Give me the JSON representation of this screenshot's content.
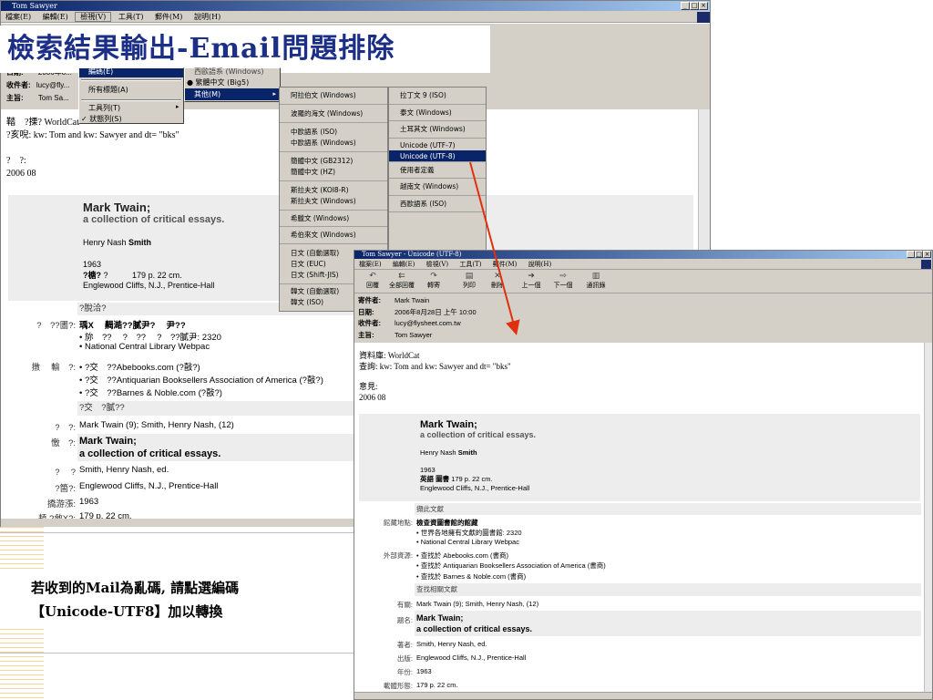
{
  "back_window": {
    "title": "Tom Sawyer",
    "menu": [
      "檔案(E)",
      "編輯(E)",
      "檢視(V)",
      "工具(T)",
      "郵件(M)",
      "說明(H)"
    ],
    "headers": [
      {
        "label": "日期:",
        "value": "2006年8..."
      },
      {
        "label": "收件者:",
        "value": "lucy@fly..."
      },
      {
        "label": "主旨:",
        "value": "Tom Sa..."
      }
    ],
    "body_lines": [
      "鞜　?搮? WorldCat",
      "?亥唲: kw: Tom and kw: Sawyer and dt= \"bks\"",
      "?　?:",
      "2006 08"
    ],
    "record": {
      "title": "Mark Twain;",
      "subtitle": "a collection of critical essays.",
      "author_prefix": "Henry Nash",
      "author_bold": "Smith",
      "year": "1963",
      "pages_label": "?榶?",
      "pages_q": "?",
      "pages": "179 p. 22 cm.",
      "publisher": "Englewood Cliffs, N.J., Prentice-Hall"
    },
    "rows": [
      {
        "label": "?脫洽?",
        "value": ""
      },
      {
        "label": "?　??圕?:",
        "value": "瑀X　 齃澔??膩尹?　 尹??"
      },
      {
        "label": "",
        "value": "• 旀　??　 ?　??　 ?　??膩尹: 2320"
      },
      {
        "label": "",
        "value": "• National Central Library Webpac"
      },
      {
        "label": "撴　 輸　?:",
        "value": "• ?交　??Abebooks.com (?敼?)"
      },
      {
        "label": "",
        "value": "• ?交　??Antiquarian Booksellers Association of America (?敼?)"
      },
      {
        "label": "",
        "value": "• ?交　??Barnes & Noble.com (?敼?)"
      },
      {
        "label": "?交　?膩??",
        "value": ""
      },
      {
        "label": "?　?:",
        "value": "Mark Twain (9); Smith, Henry Nash, (12)"
      },
      {
        "label": "憿　?:",
        "value": "Mark Twain;"
      },
      {
        "label": "",
        "value": "a collection of critical essays."
      },
      {
        "label": "?　 ?",
        "value": "Smith, Henry Nash,  ed."
      },
      {
        "label": "?箇?:",
        "value": "Englewood Cliffs, N.J., Prentice-Hall"
      },
      {
        "label": "撟游漲:",
        "value": "1963"
      },
      {
        "label": "頛 ?敹X?:",
        "value": "179 p. 22 cm."
      }
    ]
  },
  "slide_title": "檢索結果輸出-Email問題排除",
  "view_menu": {
    "items": [
      "編碼(E)",
      "所有標題(A)",
      "工具列(T)",
      "狀態列(S)"
    ]
  },
  "encoding_submenu": {
    "items": [
      "西歐語系 (Windows)",
      "繁體中文 (Big5)",
      "其他(M)"
    ]
  },
  "encoding_col1": [
    "阿拉伯文 (Windows)",
    "波羅的海文 (Windows)",
    "中歐語系 (ISO)",
    "中歐語系 (Windows)",
    "簡體中文 (GB2312)",
    "簡體中文 (HZ)",
    "斯拉夫文 (KOI8-R)",
    "斯拉夫文 (Windows)",
    "希臘文 (Windows)",
    "希伯來文 (Windows)",
    "日文 (自動選取)",
    "日文 (EUC)",
    "日文 (Shift-JIS)",
    "韓文 (自動選取)",
    "韓文 (ISO)"
  ],
  "encoding_col2": [
    "拉丁文 9 (ISO)",
    "泰文 (Windows)",
    "土耳其文 (Windows)",
    "Unicode (UTF-7)",
    "Unicode (UTF-8)",
    "使用者定義",
    "越南文 (Windows)",
    "西歐語系 (ISO)"
  ],
  "front_window": {
    "title": "Tom Sawyer - Unicode (UTF-8)",
    "menu": [
      "檔案(E)",
      "編輯(E)",
      "檢視(V)",
      "工具(T)",
      "郵件(M)",
      "說明(H)"
    ],
    "toolbar": [
      "回覆",
      "全部回覆",
      "轉寄",
      "列印",
      "刪除",
      "上一個",
      "下一個",
      "通訊錄"
    ],
    "headers": [
      {
        "label": "寄件者:",
        "value": "Mark Twain"
      },
      {
        "label": "日期:",
        "value": "2006年8月28日 上午 10:00"
      },
      {
        "label": "收件者:",
        "value": "lucy@flysheet.com.tw"
      },
      {
        "label": "主旨:",
        "value": "Tom Sawyer"
      }
    ],
    "body": {
      "line1": "資料庫: WorldCat",
      "line2": "查詢: kw: Tom and kw: Sawyer and dt= \"bks\"",
      "line3": "意見:",
      "line4": "2006 08"
    },
    "record": {
      "title": "Mark Twain;",
      "subtitle": "a collection of critical essays.",
      "author_prefix": "Henry Nash",
      "author_bold": "Smith",
      "year": "1963",
      "pages_label": "英語 圖書",
      "pages": "179 p. 22 cm.",
      "publisher": "Englewood Cliffs, N.J., Prentice-Hall"
    },
    "rows": [
      {
        "label": "",
        "value": "擷此文獻"
      },
      {
        "label": "館藏地點:",
        "value": "檢查資圖書館的館藏"
      },
      {
        "label": "",
        "value": "• 世界各地擁有文獻的圖書館: 2320"
      },
      {
        "label": "",
        "value": "• National Central Library Webpac"
      },
      {
        "label": "外部資源:",
        "value": "• 查找於 Abebooks.com (書商)"
      },
      {
        "label": "",
        "value": "• 查找於 Antiquarian Booksellers Association of America (書商)"
      },
      {
        "label": "",
        "value": "• 查找於 Barnes & Noble.com (書商)"
      },
      {
        "label": "",
        "value": "查找相關文獻"
      },
      {
        "label": "有關:",
        "value": "Mark Twain (9); Smith, Henry Nash, (12)"
      },
      {
        "label": "題名:",
        "value": "Mark Twain;"
      },
      {
        "label": "",
        "value": "a collection of critical essays."
      },
      {
        "label": "著者:",
        "value": "Smith, Henry Nash,  ed."
      },
      {
        "label": "出版:",
        "value": "Englewood Cliffs, N.J., Prentice-Hall"
      },
      {
        "label": "年份:",
        "value": "1963"
      },
      {
        "label": "載體形態:",
        "value": "179 p. 22 cm."
      }
    ]
  },
  "callout": {
    "line1": "若收到的Mail為亂碼, 請點選編碼",
    "line2": "【Unicode-UTF8】加以轉換"
  },
  "colors": {
    "title_blue": "#1c2f86",
    "highlight": "#0a246a",
    "arrow": "#e03010",
    "menu_gray": "#d4d0c8"
  }
}
